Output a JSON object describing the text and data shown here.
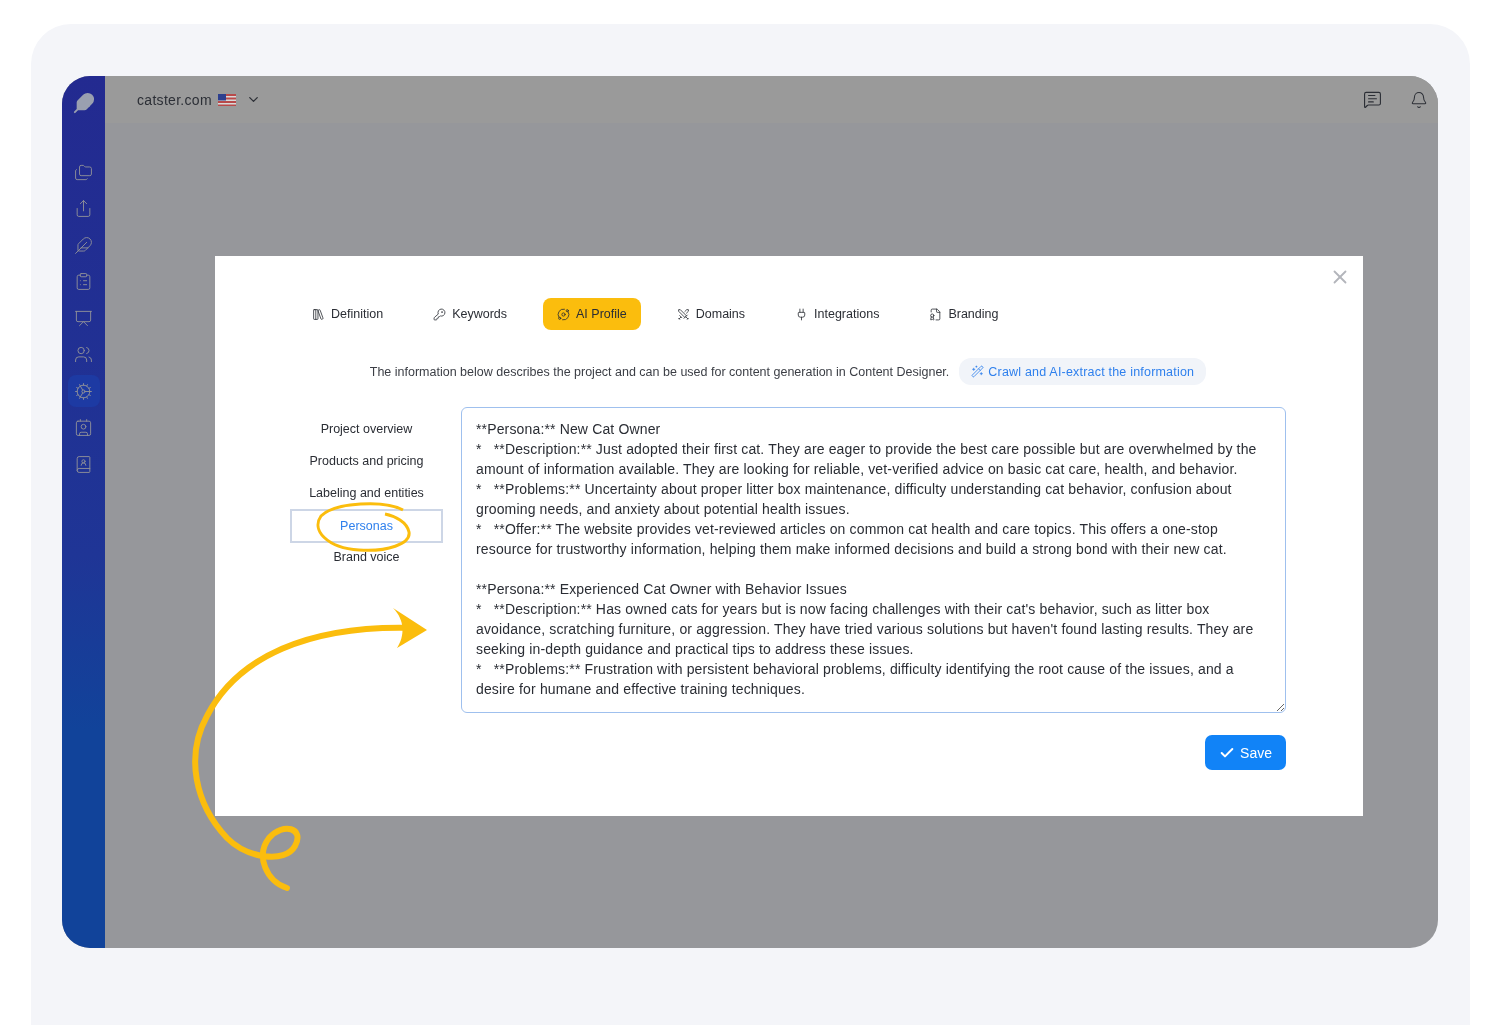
{
  "sidebar": {
    "items": [
      {
        "selected": false
      },
      {
        "selected": false
      },
      {
        "selected": false
      },
      {
        "selected": false
      },
      {
        "selected": false
      },
      {
        "selected": false
      },
      {
        "selected": true
      },
      {
        "selected": false
      },
      {
        "selected": false
      }
    ]
  },
  "topbar": {
    "site": "catster.com"
  },
  "modal": {
    "tabs": [
      {
        "label": "Definition",
        "selected": false
      },
      {
        "label": "Keywords",
        "selected": false
      },
      {
        "label": "AI Profile",
        "selected": true
      },
      {
        "label": "Domains",
        "selected": false
      },
      {
        "label": "Integrations",
        "selected": false
      },
      {
        "label": "Branding",
        "selected": false
      }
    ],
    "description": "The information below describes the project and can be used for content generation in Content Designer.",
    "crawl_button": "Crawl and AI-extract the information",
    "sections": [
      {
        "label": "Project overview",
        "selected": false
      },
      {
        "label": "Products and pricing",
        "selected": false
      },
      {
        "label": "Labeling and entities",
        "selected": false
      },
      {
        "label": "Personas",
        "selected": true
      },
      {
        "label": "Brand voice",
        "selected": false
      }
    ],
    "content": "**Persona:** New Cat Owner\n*   **Description:** Just adopted their first cat. They are eager to provide the best care possible but are overwhelmed by the amount of information available. They are looking for reliable, vet-verified advice on basic cat care, health, and behavior.\n*   **Problems:** Uncertainty about proper litter box maintenance, difficulty understanding cat behavior, confusion about grooming needs, and anxiety about potential health issues.\n*   **Offer:** The website provides vet-reviewed articles on common cat health and care topics. This offers a one-stop resource for trustworthy information, helping them make informed decisions and build a strong bond with their new cat.\n\n**Persona:** Experienced Cat Owner with Behavior Issues\n*   **Description:** Has owned cats for years but is now facing challenges with their cat's behavior, such as litter box avoidance, scratching furniture, or aggression. They have tried various solutions but haven't found lasting results. They are seeking in-depth guidance and practical tips to address these issues.\n*   **Problems:** Frustration with persistent behavioral problems, difficulty identifying the root cause of the issues, and a desire for humane and effective training techniques.",
    "save_button": "Save"
  }
}
